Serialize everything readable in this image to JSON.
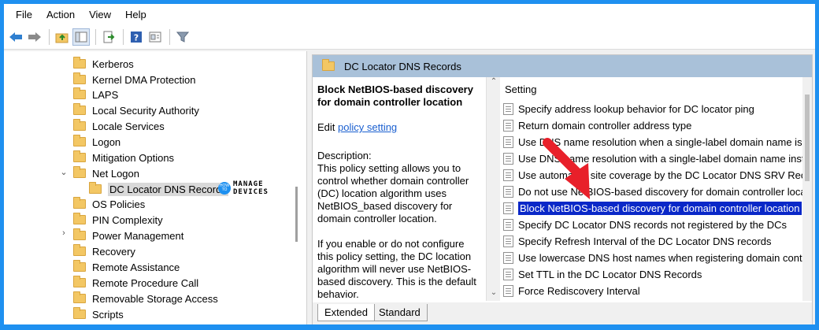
{
  "menu": [
    "File",
    "Action",
    "View",
    "Help"
  ],
  "toolbar": {
    "buttons": [
      "back-icon",
      "forward-icon",
      "up-folder-icon",
      "show-hide-tree-icon",
      "export-list-icon",
      "help-icon",
      "properties-icon",
      "filter-icon"
    ]
  },
  "tree": {
    "items": [
      {
        "label": "Kerberos"
      },
      {
        "label": "Kernel DMA Protection"
      },
      {
        "label": "LAPS"
      },
      {
        "label": "Local Security Authority"
      },
      {
        "label": "Locale Services"
      },
      {
        "label": "Logon"
      },
      {
        "label": "Mitigation Options"
      },
      {
        "label": "Net Logon",
        "expander": "⌄"
      },
      {
        "label": "DC Locator DNS Records"
      },
      {
        "label": "OS Policies"
      },
      {
        "label": "PIN Complexity"
      },
      {
        "label": "Power Management",
        "expander": "›"
      },
      {
        "label": "Recovery"
      },
      {
        "label": "Remote Assistance"
      },
      {
        "label": "Remote Procedure Call"
      },
      {
        "label": "Removable Storage Access"
      },
      {
        "label": "Scripts"
      }
    ],
    "selected": "DC Locator DNS Records"
  },
  "watermark": {
    "circle": "HOW TO",
    "line1": "MANAGE",
    "line2": "DEVICES"
  },
  "pane": {
    "header": "DC Locator DNS Records",
    "description": {
      "title": "Block NetBIOS-based discovery for domain controller location",
      "edit_prefix": "Edit ",
      "edit_link": "policy setting",
      "label": "Description:",
      "para1": "This policy setting allows you to control whether domain controller (DC) location algorithm uses NetBIOS_based discovery for domain controller location.",
      "para2": "If you enable or do not configure this policy setting, the DC location algorithm will never use NetBIOS-based discovery. This is the default behavior."
    },
    "settings_header": "Setting",
    "settings": [
      "Specify address lookup behavior for DC locator ping",
      "Return domain controller address type",
      "Use DNS name resolution when a single-label domain name is used",
      "Use DNS name resolution with a single-label domain name instead of NetBIOS",
      "Use automated site coverage by the DC Locator DNS SRV Records",
      "Do not use NetBIOS-based discovery for domain controller location",
      "Block NetBIOS-based discovery for domain controller location",
      "Specify DC Locator DNS records not registered by the DCs",
      "Specify Refresh Interval of the DC Locator DNS records",
      "Use lowercase DNS host names when registering domain controller",
      "Set TTL  in the DC Locator DNS Records",
      "Force Rediscovery Interval"
    ],
    "selected_setting_index": 6,
    "tabs": [
      "Extended",
      "Standard"
    ]
  },
  "colors": {
    "selection": "#0a28c8",
    "header": "#a9c1d9",
    "arrow": "#e8202a",
    "frame": "#1e90f0"
  }
}
